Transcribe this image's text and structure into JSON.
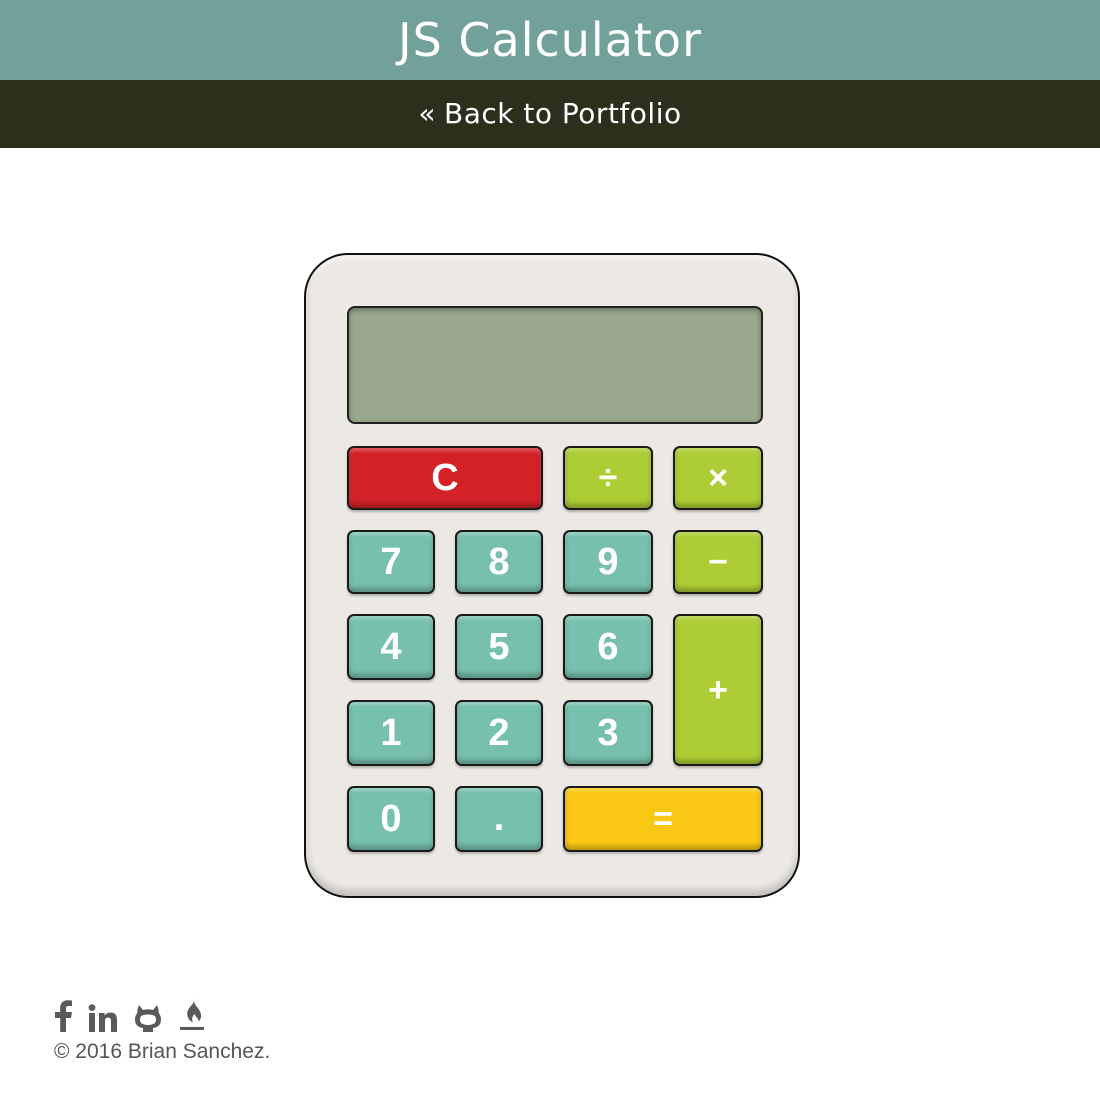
{
  "header": {
    "title": "JS Calculator",
    "back_link": {
      "chevron": "«",
      "label": "Back to Portfolio"
    }
  },
  "calculator": {
    "display_value": "",
    "keys": {
      "clear": "C",
      "divide": "÷",
      "multiply": "×",
      "subtract": "−",
      "add": "+",
      "equals": "=",
      "decimal": ".",
      "seven": "7",
      "eight": "8",
      "nine": "9",
      "four": "4",
      "five": "5",
      "six": "6",
      "one": "1",
      "two": "2",
      "three": "3",
      "zero": "0"
    },
    "colors": {
      "number": "#77c0ad",
      "operator": "#adcd35",
      "clear": "#d32128",
      "equals": "#f9c814",
      "display": "#9aa98d",
      "body": "#ece9e4"
    }
  },
  "footer": {
    "social_icons": [
      "facebook-icon",
      "linkedin-icon",
      "github-icon",
      "freecodecamp-icon"
    ],
    "copyright": "© 2016 Brian Sanchez."
  },
  "theme": {
    "title_bar": "#72a09a",
    "nav_bar": "#2c2f1b"
  }
}
